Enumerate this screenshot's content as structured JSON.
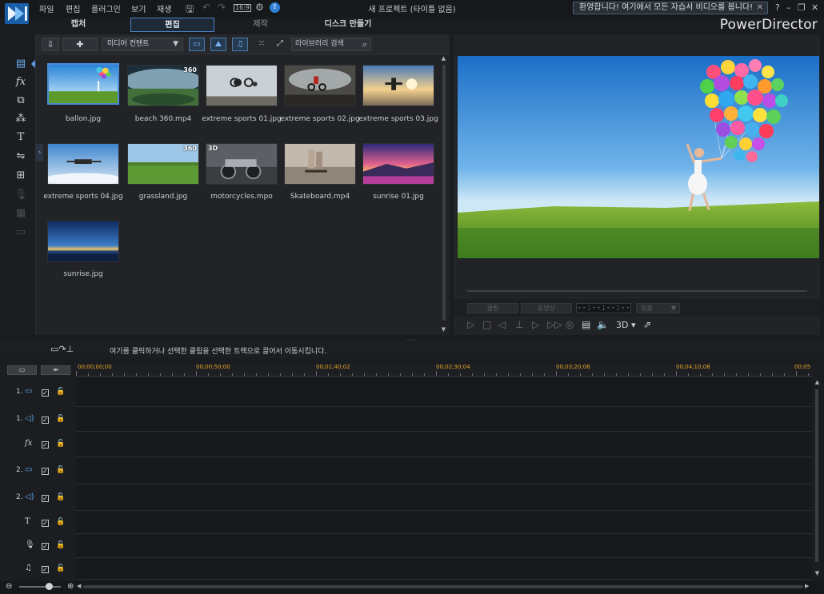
{
  "titlebar": {
    "menu": [
      "파일",
      "편집",
      "플러그인",
      "보기",
      "재생"
    ],
    "title": "새 프로젝트 (타이틀 없음)",
    "welcome": "환영합니다! 여기에서 모든 자습서 비디오를 봅니다!",
    "aspect": "16:9",
    "icons": [
      "save-icon",
      "undo-icon",
      "redo-icon",
      "aspect-icon",
      "settings-icon",
      "upgrade-icon"
    ],
    "window_buttons": [
      "?",
      "–",
      "❐",
      "✕"
    ]
  },
  "mode_tabs": [
    {
      "label": "캡처",
      "state": "normal"
    },
    {
      "label": "편집",
      "state": "active"
    },
    {
      "label": "제작",
      "state": "disabled"
    },
    {
      "label": "디스크 만들기",
      "state": "normal"
    }
  ],
  "brand": "PowerDirector",
  "rail": [
    "media-room-icon",
    "effects-icon",
    "pip-icon",
    "particle-icon",
    "title-icon",
    "transition-icon",
    "audio-mix-icon",
    "voice-record-icon",
    "chapter-icon",
    "subtitle-icon"
  ],
  "library": {
    "media_select": "미디어 컨텐트",
    "search_placeholder": "라이브러리 검색",
    "items": [
      {
        "label": "ballon.jpg",
        "badge": ""
      },
      {
        "label": "beach 360.mp4",
        "badge": "360"
      },
      {
        "label": "extreme sports 01.jpg",
        "badge": ""
      },
      {
        "label": "extreme sports 02.jpg",
        "badge": ""
      },
      {
        "label": "extreme sports 03.jpg",
        "badge": ""
      },
      {
        "label": "extreme sports 04.jpg",
        "badge": ""
      },
      {
        "label": "grassland.jpg",
        "badge": "360"
      },
      {
        "label": "motorcycles.mpo",
        "badge": "3D"
      },
      {
        "label": "Skateboard.mp4",
        "badge": ""
      },
      {
        "label": "sunrise 01.jpg",
        "badge": ""
      },
      {
        "label": "sunrise.jpg",
        "badge": ""
      }
    ]
  },
  "preview": {
    "clip_btn": "클립",
    "movie_btn": "동영상",
    "timecode": "- - ; - - ; - - ; - -",
    "fit": "맞춤",
    "mode_3d": "3D"
  },
  "timeline": {
    "hint": "여기를 클릭하거나 선택한 클립을 선택한 트랙으로 끌어서 이동시킵니다.",
    "ruler": [
      "00;00;00;00",
      "00;00;50;00",
      "00;01;40;02",
      "00;02;30;04",
      "00;03;20;06",
      "00;04;10;08",
      "00;05"
    ],
    "tracks": [
      {
        "num": "1.",
        "type": "video"
      },
      {
        "num": "1.",
        "type": "audio"
      },
      {
        "num": "",
        "type": "fx"
      },
      {
        "num": "2.",
        "type": "video"
      },
      {
        "num": "2.",
        "type": "audio"
      },
      {
        "num": "",
        "type": "title"
      },
      {
        "num": "",
        "type": "voice"
      },
      {
        "num": "",
        "type": "music"
      }
    ]
  },
  "colors": {
    "accent": "#4a8ad6",
    "ruler_text": "#e3a52b",
    "bg": "#1b1c1f"
  }
}
